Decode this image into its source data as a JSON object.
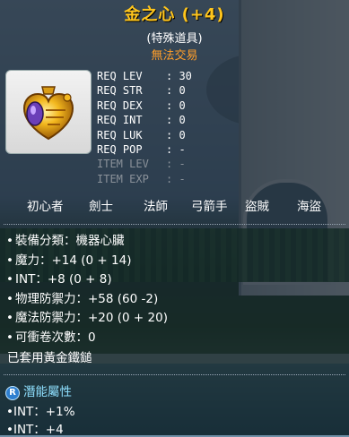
{
  "item": {
    "name": "金之心 (+4)",
    "type": "(特殊道具)",
    "trade": "無法交易",
    "icon": "golden-heart-icon"
  },
  "requirements": [
    {
      "label": "REQ LEV",
      "value": ": 30",
      "dim": false
    },
    {
      "label": "REQ STR",
      "value": ": 0",
      "dim": false
    },
    {
      "label": "REQ DEX",
      "value": ": 0",
      "dim": false
    },
    {
      "label": "REQ INT",
      "value": ": 0",
      "dim": false
    },
    {
      "label": "REQ LUK",
      "value": ": 0",
      "dim": false
    },
    {
      "label": "REQ POP",
      "value": ": -",
      "dim": false
    },
    {
      "label": "ITEM LEV",
      "value": ": -",
      "dim": true
    },
    {
      "label": "ITEM EXP",
      "value": ": -",
      "dim": true
    }
  ],
  "jobs": [
    "初心者",
    "劍士",
    "法師",
    "弓箭手",
    "盜賊",
    "海盜"
  ],
  "stats": [
    "裝備分類：機器心臟",
    "魔力：+14 (0 + 14)",
    "INT：+8 (0 + 8)",
    "物理防禦力：+58 (60 -2)",
    "魔法防禦力：+20 (0 + 20)",
    "可衝卷次數：0"
  ],
  "note": "已套用黃金鐵鎚",
  "potential": {
    "rank_letter": "R",
    "title": "潛能屬性",
    "lines": [
      "INT：+1%",
      "INT：+4"
    ]
  },
  "colors": {
    "title": "#ffc51c",
    "trade": "#ff9e2a",
    "potential": "#8fe0ff"
  }
}
